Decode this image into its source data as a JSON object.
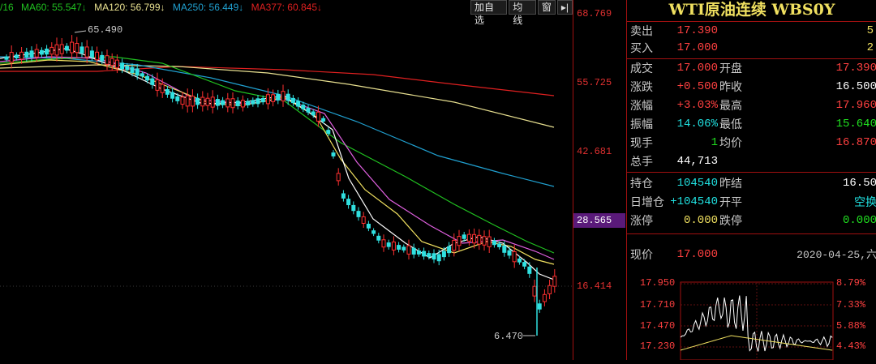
{
  "ma_bar": {
    "ma_partial": "/16",
    "ma60": "MA60: 55.547↓",
    "ma120": "MA120: 56.799↓",
    "ma250": "MA250: 56.449↓",
    "ma377": "MA377: 60.845↓"
  },
  "toolbar": {
    "add_self": "加自选",
    "ma": "均线",
    "window": "窗",
    "expand_icon": "▸|"
  },
  "price_axis": {
    "t1": "68.769",
    "t2": "55.725",
    "t3": "42.681",
    "t4": "28.565",
    "t5": "16.414"
  },
  "annotations": {
    "high": "65.490",
    "low": "6.470"
  },
  "colors": {
    "up": "#ff3030",
    "down": "#30e0e0",
    "ma5": "#ffffff",
    "ma10": "#f0e060",
    "ma20": "#e060e0",
    "ma60": "#20c020",
    "ma120": "#20a0d0",
    "ma250": "#e8e090",
    "ma377": "#e02020"
  },
  "panel": {
    "title": "WTI原油连续 WBS0Y",
    "sell": {
      "label": "卖出",
      "price": "17.390",
      "vol": "5"
    },
    "buy": {
      "label": "买入",
      "price": "17.000",
      "vol": "2"
    },
    "r1": {
      "l1": "成交",
      "v1": "17.000",
      "l2": "开盘",
      "v2": "17.390"
    },
    "r2": {
      "l1": "涨跌",
      "v1": "+0.500",
      "l2": "昨收",
      "v2": "16.500"
    },
    "r3": {
      "l1": "涨幅",
      "v1": "+3.03%",
      "l2": "最高",
      "v2": "17.960"
    },
    "r4": {
      "l1": "振幅",
      "v1": "14.06%",
      "l2": "最低",
      "v2": "15.640"
    },
    "r5": {
      "l1": "现手",
      "v1": "1",
      "l2": "均价",
      "v2": "16.870"
    },
    "r6": {
      "l1": "总手",
      "v1": "44,713"
    },
    "r7": {
      "l1": "持仓",
      "v1": "104540",
      "l2": "昨结",
      "v2": "16.50"
    },
    "r8": {
      "l1": "日增仓",
      "v1": "+104540",
      "l2": "开平",
      "v2": "空换"
    },
    "r9": {
      "l1": "涨停",
      "v1": "0.000",
      "l2": "跌停",
      "v2": "0.000"
    },
    "now": {
      "label": "现价",
      "price": "17.000",
      "date": "2020-04-25,六"
    },
    "sub": {
      "p1": "17.950",
      "p2": "17.710",
      "p3": "17.470",
      "p4": "17.230",
      "c1": "8.79%",
      "c2": "7.33%",
      "c3": "5.88%",
      "c4": "4.43%"
    }
  }
}
